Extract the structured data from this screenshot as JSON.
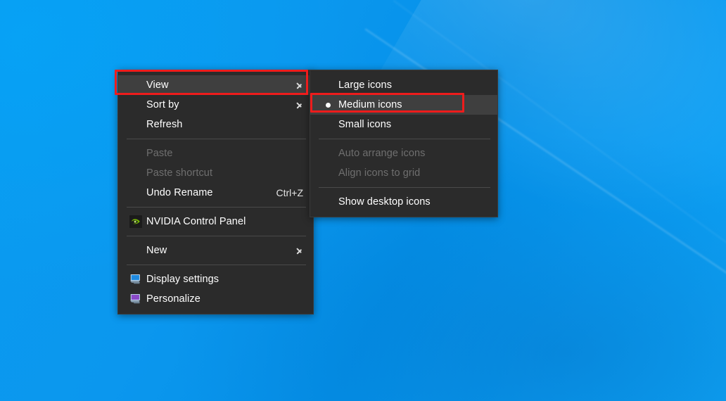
{
  "desktop": {
    "wallpaper_base_color": "#0b97ee",
    "wallpaper_accent_color": "#0fa5f7"
  },
  "annotations": {
    "accent_color": "#ee1c1c",
    "items": [
      {
        "name": "view-highlight",
        "target": "View"
      },
      {
        "name": "medium-icons-highlight",
        "target": "Medium icons"
      }
    ]
  },
  "context_menu": {
    "name": "desktop-context-menu",
    "background": "#2b2b2b",
    "hover_background": "#3f3f3f",
    "items": [
      {
        "label": "View",
        "submenu": true,
        "hover": true,
        "disabled": false,
        "accel": "",
        "icon": ""
      },
      {
        "label": "Sort by",
        "submenu": true,
        "hover": false,
        "disabled": false,
        "accel": "",
        "icon": ""
      },
      {
        "label": "Refresh",
        "submenu": false,
        "hover": false,
        "disabled": false,
        "accel": "",
        "icon": ""
      },
      {
        "separator": true
      },
      {
        "label": "Paste",
        "submenu": false,
        "hover": false,
        "disabled": true,
        "accel": "",
        "icon": ""
      },
      {
        "label": "Paste shortcut",
        "submenu": false,
        "hover": false,
        "disabled": true,
        "accel": "",
        "icon": ""
      },
      {
        "label": "Undo Rename",
        "submenu": false,
        "hover": false,
        "disabled": false,
        "accel": "Ctrl+Z",
        "icon": ""
      },
      {
        "separator": true
      },
      {
        "label": "NVIDIA Control Panel",
        "submenu": false,
        "hover": false,
        "disabled": false,
        "accel": "",
        "icon": "nvidia-icon"
      },
      {
        "separator": true
      },
      {
        "label": "New",
        "submenu": true,
        "hover": false,
        "disabled": false,
        "accel": "",
        "icon": ""
      },
      {
        "separator": true
      },
      {
        "label": "Display settings",
        "submenu": false,
        "hover": false,
        "disabled": false,
        "accel": "",
        "icon": "display-settings-icon"
      },
      {
        "label": "Personalize",
        "submenu": false,
        "hover": false,
        "disabled": false,
        "accel": "",
        "icon": "personalize-icon"
      }
    ]
  },
  "view_submenu": {
    "name": "view-submenu",
    "items": [
      {
        "label": "Large icons",
        "selected": false,
        "hover": false,
        "disabled": false
      },
      {
        "label": "Medium icons",
        "selected": true,
        "hover": true,
        "disabled": false
      },
      {
        "label": "Small icons",
        "selected": false,
        "hover": false,
        "disabled": false
      },
      {
        "separator": true
      },
      {
        "label": "Auto arrange icons",
        "selected": false,
        "hover": false,
        "disabled": true
      },
      {
        "label": "Align icons to grid",
        "selected": false,
        "hover": false,
        "disabled": true
      },
      {
        "separator": true
      },
      {
        "label": "Show desktop icons",
        "selected": false,
        "hover": false,
        "disabled": false
      }
    ]
  }
}
